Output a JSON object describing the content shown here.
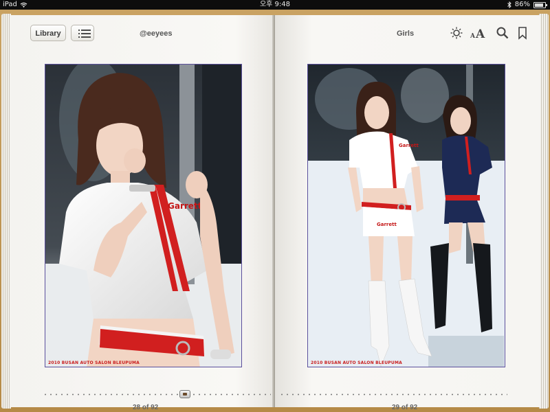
{
  "status": {
    "device": "iPad",
    "time": "오후 9:48",
    "battery": "86%",
    "battery_level": 0.86
  },
  "toolbar": {
    "library_label": "Library",
    "left_header": "@eeyees",
    "right_header": "Girls",
    "icons": [
      "toc-list-icon",
      "brightness-icon",
      "font-size-icon",
      "search-icon",
      "bookmark-icon"
    ]
  },
  "pages": {
    "left": {
      "caption": "2010 BUSAN AUTO SALON BLEUPUMA",
      "page_label": "28 of 92"
    },
    "right": {
      "caption": "2010 BUSAN AUTO SALON BLEUPUMA",
      "page_label": "29 of 92"
    }
  },
  "colors": {
    "frame": "#c9a262",
    "page": "#f7f6f3",
    "caption": "#c91c1c",
    "photo_border": "#5a4f9c"
  }
}
